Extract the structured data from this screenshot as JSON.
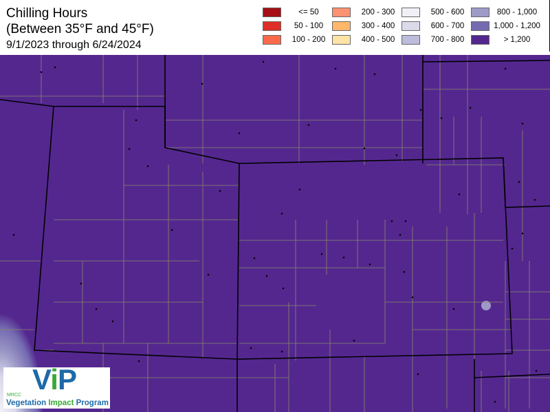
{
  "title": {
    "line1": "Chilling Hours",
    "line2": "(Between 35°F and 45°F)",
    "date_range": "9/1/2023 through 6/24/2024"
  },
  "legend": [
    {
      "label": "<= 50",
      "color": "#a50f15"
    },
    {
      "label": "50 - 100",
      "color": "#de2d26"
    },
    {
      "label": "100 - 200",
      "color": "#fb6a4a"
    },
    {
      "label": "200 - 300",
      "color": "#fc9272"
    },
    {
      "label": "300 - 400",
      "color": "#feb76b"
    },
    {
      "label": "400 - 500",
      "color": "#fee3a6"
    },
    {
      "label": "500 - 600",
      "color": "#f2f0f7"
    },
    {
      "label": "600 - 700",
      "color": "#dadaeb"
    },
    {
      "label": "700 - 800",
      "color": "#bcbddc"
    },
    {
      "label": "800 - 1,000",
      "color": "#9e9ac8"
    },
    {
      "label": "1,000 - 1,200",
      "color": "#756bb1"
    },
    {
      "label": "> 1,200",
      "color": "#54278f"
    }
  ],
  "logo": {
    "mark": "ViP",
    "org": "MRCC",
    "name_part1": "Vegetation",
    "name_part2": "Impact",
    "name_part3": "Program"
  }
}
